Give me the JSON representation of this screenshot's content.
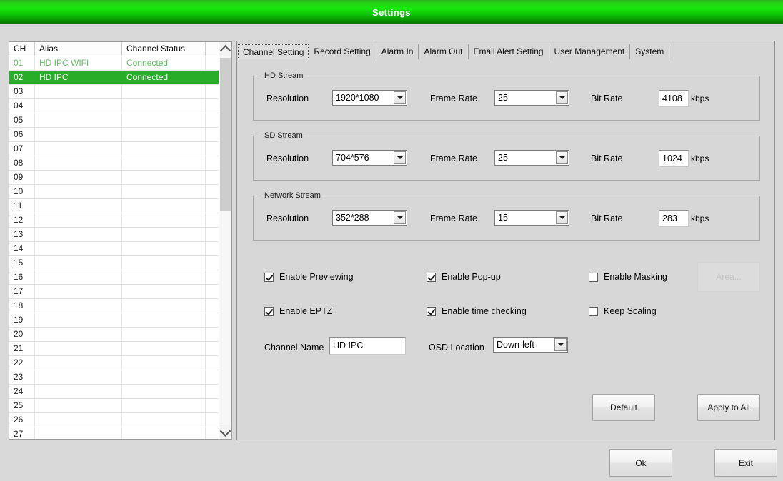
{
  "window": {
    "title": "Settings"
  },
  "channel_list": {
    "columns": [
      "CH",
      "Alias",
      "Channel Status"
    ],
    "rows": [
      {
        "ch": "01",
        "alias": "HD IPC WIFI",
        "status": "Connected",
        "state": "connected"
      },
      {
        "ch": "02",
        "alias": "HD IPC",
        "status": "Connected",
        "state": "selected"
      },
      {
        "ch": "03",
        "alias": "",
        "status": "",
        "state": "empty"
      },
      {
        "ch": "04",
        "alias": "",
        "status": "",
        "state": "empty"
      },
      {
        "ch": "05",
        "alias": "",
        "status": "",
        "state": "empty"
      },
      {
        "ch": "06",
        "alias": "",
        "status": "",
        "state": "empty"
      },
      {
        "ch": "07",
        "alias": "",
        "status": "",
        "state": "empty"
      },
      {
        "ch": "08",
        "alias": "",
        "status": "",
        "state": "empty"
      },
      {
        "ch": "09",
        "alias": "",
        "status": "",
        "state": "empty"
      },
      {
        "ch": "10",
        "alias": "",
        "status": "",
        "state": "empty"
      },
      {
        "ch": "11",
        "alias": "",
        "status": "",
        "state": "empty"
      },
      {
        "ch": "12",
        "alias": "",
        "status": "",
        "state": "empty"
      },
      {
        "ch": "13",
        "alias": "",
        "status": "",
        "state": "empty"
      },
      {
        "ch": "14",
        "alias": "",
        "status": "",
        "state": "empty"
      },
      {
        "ch": "15",
        "alias": "",
        "status": "",
        "state": "empty"
      },
      {
        "ch": "16",
        "alias": "",
        "status": "",
        "state": "empty"
      },
      {
        "ch": "17",
        "alias": "",
        "status": "",
        "state": "empty"
      },
      {
        "ch": "18",
        "alias": "",
        "status": "",
        "state": "empty"
      },
      {
        "ch": "19",
        "alias": "",
        "status": "",
        "state": "empty"
      },
      {
        "ch": "20",
        "alias": "",
        "status": "",
        "state": "empty"
      },
      {
        "ch": "21",
        "alias": "",
        "status": "",
        "state": "empty"
      },
      {
        "ch": "22",
        "alias": "",
        "status": "",
        "state": "empty"
      },
      {
        "ch": "23",
        "alias": "",
        "status": "",
        "state": "empty"
      },
      {
        "ch": "24",
        "alias": "",
        "status": "",
        "state": "empty"
      },
      {
        "ch": "25",
        "alias": "",
        "status": "",
        "state": "empty"
      },
      {
        "ch": "26",
        "alias": "",
        "status": "",
        "state": "empty"
      },
      {
        "ch": "27",
        "alias": "",
        "status": "",
        "state": "empty"
      }
    ],
    "scrollbar": {
      "up_icon": "chevron-up-icon",
      "down_icon": "chevron-down-icon"
    }
  },
  "tabs": [
    {
      "label": "Channel Setting",
      "active": true
    },
    {
      "label": "Record Setting",
      "active": false
    },
    {
      "label": "Alarm In",
      "active": false
    },
    {
      "label": "Alarm Out",
      "active": false
    },
    {
      "label": "Email Alert Setting",
      "active": false
    },
    {
      "label": "User Management",
      "active": false
    },
    {
      "label": "System",
      "active": false
    }
  ],
  "labels": {
    "resolution": "Resolution",
    "frame_rate": "Frame Rate",
    "bit_rate": "Bit Rate",
    "kbps": "kbps",
    "channel_name": "Channel Name",
    "osd_location": "OSD Location"
  },
  "streams": [
    {
      "id": "hd",
      "legend": "HD Stream",
      "resolution": "1920*1080",
      "frame_rate": "25",
      "bit_rate": "4108"
    },
    {
      "id": "sd",
      "legend": "SD Stream",
      "resolution": "704*576",
      "frame_rate": "25",
      "bit_rate": "1024"
    },
    {
      "id": "net",
      "legend": "Network Stream",
      "resolution": "352*288",
      "frame_rate": "15",
      "bit_rate": "283"
    }
  ],
  "checkboxes": [
    {
      "label": "Enable Previewing",
      "checked": true
    },
    {
      "label": "Enable Pop-up",
      "checked": true
    },
    {
      "label": "Enable Masking",
      "checked": false
    },
    {
      "label": "Enable EPTZ",
      "checked": true
    },
    {
      "label": "Enable time checking",
      "checked": true
    },
    {
      "label": "Keep Scaling",
      "checked": false
    }
  ],
  "fields": {
    "channel_name_value": "HD IPC",
    "osd_location_value": "Down-left"
  },
  "buttons": {
    "area": "Area...",
    "default": "Default",
    "apply_to_all": "Apply to All",
    "ok": "Ok",
    "exit": "Exit"
  },
  "colors": {
    "title_green": "#18e80a",
    "selected_row": "#27ad27",
    "connected_text": "#63c164",
    "panel_bg": "#d7d7d7"
  }
}
